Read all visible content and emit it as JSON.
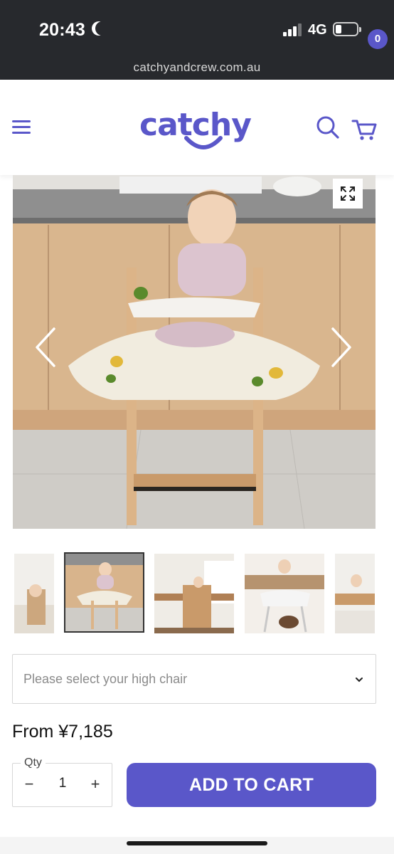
{
  "status_bar": {
    "time": "20:43",
    "network": "4G"
  },
  "browser": {
    "url": "catchyandcrew.com.au"
  },
  "header": {
    "logo_text": "catchy",
    "cart_count": "0"
  },
  "product": {
    "select_placeholder": "Please select your high chair",
    "price": "From ¥7,185",
    "qty_label": "Qty",
    "qty_value": "1",
    "qty_minus": "−",
    "qty_plus": "+",
    "add_to_cart": "ADD TO CART"
  },
  "colors": {
    "brand": "#5a57c9",
    "status_bar": "#27292d"
  },
  "icons": {
    "menu": "hamburger-icon",
    "search": "search-icon",
    "cart": "cart-icon",
    "expand": "expand-icon",
    "prev": "chevron-left-icon",
    "next": "chevron-right-icon",
    "select": "chevron-down-icon"
  }
}
